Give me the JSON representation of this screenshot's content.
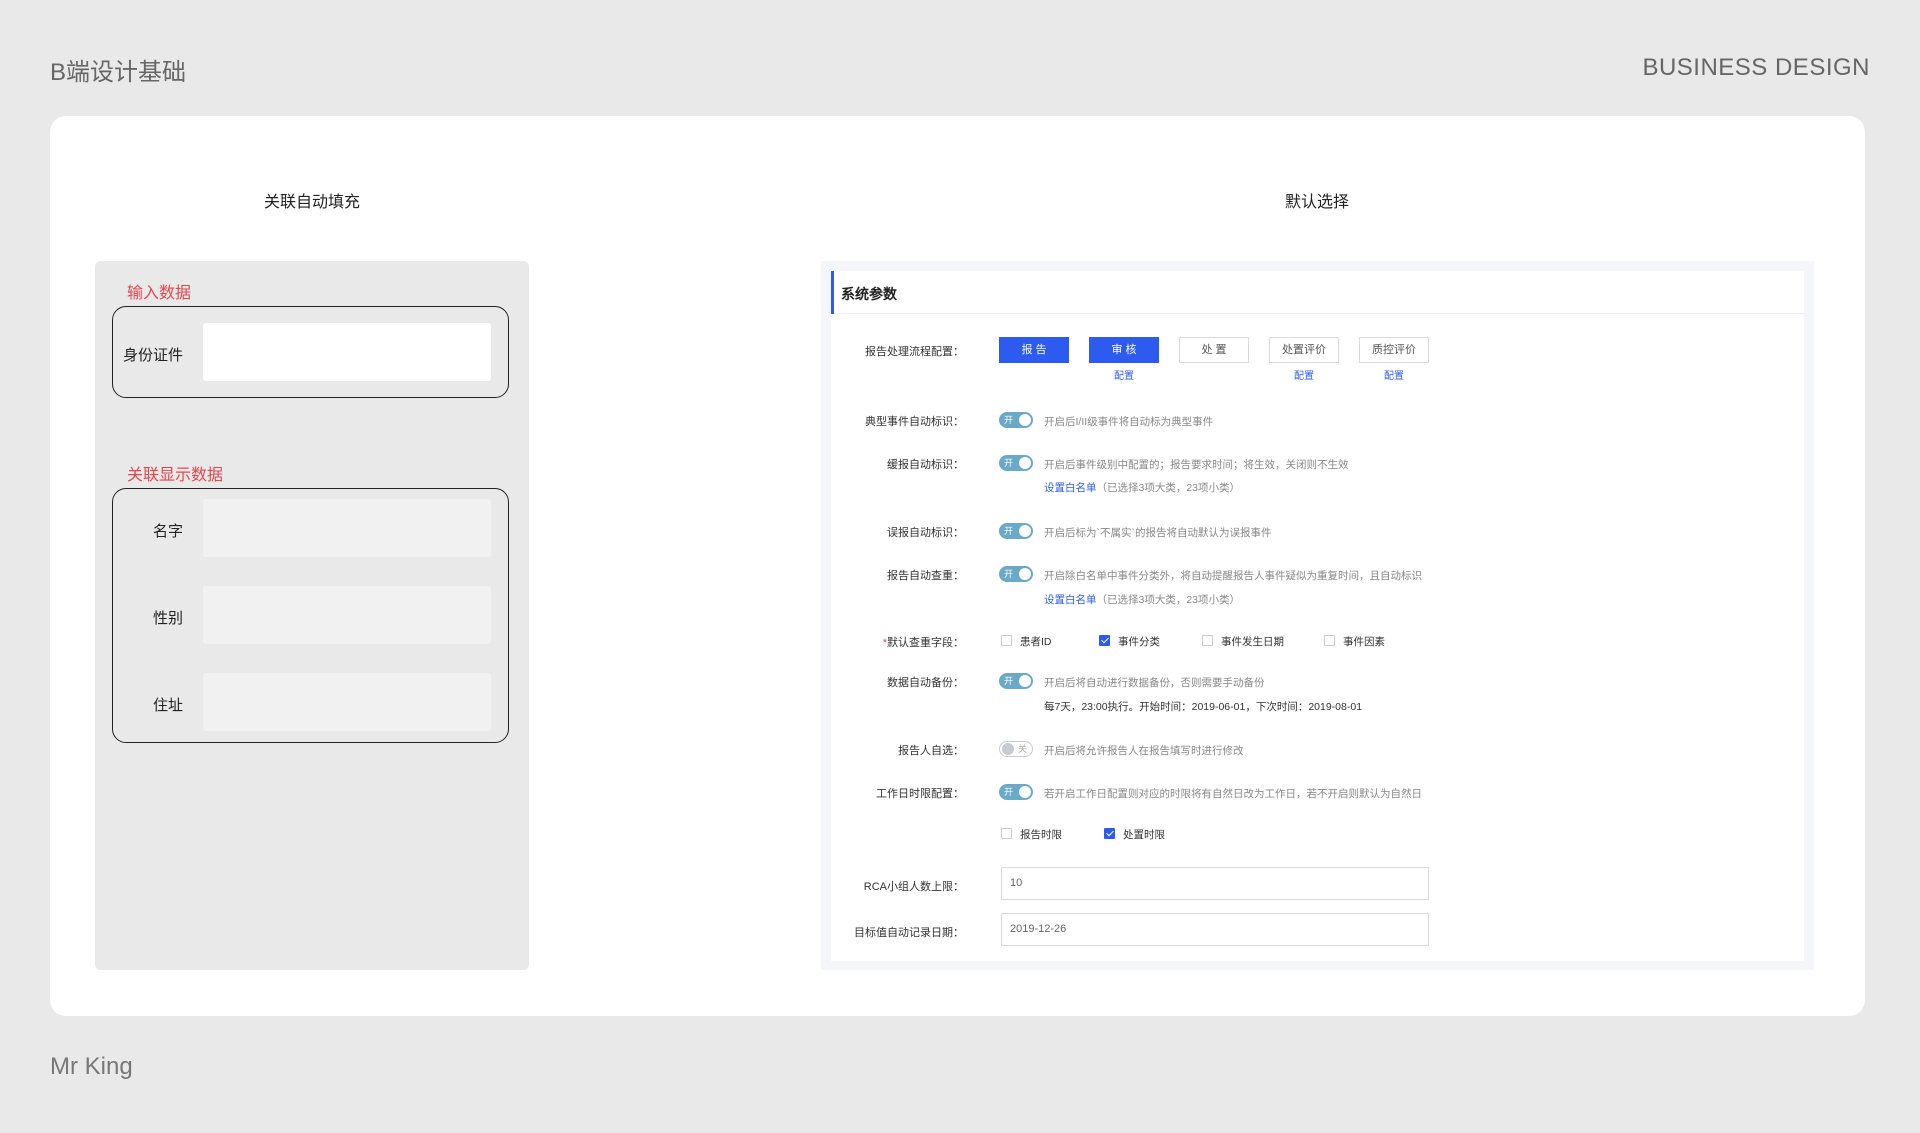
{
  "header": {
    "left_title": "B端设计基础",
    "right_title": "BUSINESS DESIGN"
  },
  "footer": {
    "author": "Mr King"
  },
  "left_section": {
    "title": "关联自动填充",
    "input_group_label": "输入数据",
    "input_fields": [
      {
        "label": "身份证件",
        "value": ""
      }
    ],
    "display_group_label": "关联显示数据",
    "display_fields": [
      {
        "label": "名字",
        "value": ""
      },
      {
        "label": "性别",
        "value": ""
      },
      {
        "label": "住址",
        "value": ""
      }
    ]
  },
  "right_section": {
    "title": "默认选择",
    "panel_title": "系统参数",
    "process": {
      "label": "报告处理流程配置：",
      "steps": [
        {
          "label": "报 告",
          "active": true,
          "config": ""
        },
        {
          "label": "审 核",
          "active": true,
          "config": "配置"
        },
        {
          "label": "处 置",
          "active": false,
          "config": ""
        },
        {
          "label": "处置评价",
          "active": false,
          "config": "配置"
        },
        {
          "label": "质控评价",
          "active": false,
          "config": "配置"
        }
      ]
    },
    "switches": [
      {
        "label": "典型事件自动标识：",
        "state": "开",
        "on": true,
        "desc": "开启后I/II级事件将自动标为典型事件",
        "link": "",
        "link_note": ""
      },
      {
        "label": "缓报自动标识：",
        "state": "开",
        "on": true,
        "desc": "开启后事件级别中配置的；报告要求时间；将生效，关闭则不生效",
        "link": "设置白名单",
        "link_note": "（已选择3项大类，23项小类）"
      },
      {
        "label": "误报自动标识：",
        "state": "开",
        "on": true,
        "desc": "开启后标为`不属实`的报告将自动默认为误报事件",
        "link": "",
        "link_note": ""
      },
      {
        "label": "报告自动查重：",
        "state": "开",
        "on": true,
        "desc": "开启除白名单中事件分类外，将自动提醒报告人事件疑似为重复时间，且自动标识",
        "link": "设置白名单",
        "link_note": "（已选择3项大类，23项小类）"
      }
    ],
    "dedupe": {
      "star": "*",
      "label": "默认查重字段：",
      "options": [
        {
          "label": "患者ID",
          "checked": false
        },
        {
          "label": "事件分类",
          "checked": true
        },
        {
          "label": "事件发生日期",
          "checked": false
        },
        {
          "label": "事件因素",
          "checked": false
        }
      ]
    },
    "backup": {
      "label": "数据自动备份：",
      "state": "开",
      "desc": "开启后将自动进行数据备份，否则需要手动备份",
      "schedule": "每7天，23:00执行。开始时间：2019-06-01，下次时间：2019-08-01"
    },
    "self_select": {
      "label": "报告人自选：",
      "state": "关",
      "desc": "开启后将允许报告人在报告填写时进行修改"
    },
    "workday": {
      "label": "工作日时限配置：",
      "state": "开",
      "desc": "若开启工作日配置则对应的时限将有自然日改为工作日，若不开启则默认为自然日",
      "options": [
        {
          "label": "报告时限",
          "checked": false
        },
        {
          "label": "处置时限",
          "checked": true
        }
      ]
    },
    "rca": {
      "label": "RCA小组人数上限：",
      "value": "10"
    },
    "target_date": {
      "label": "目标值自动记录日期：",
      "value": "2019-12-26"
    }
  }
}
